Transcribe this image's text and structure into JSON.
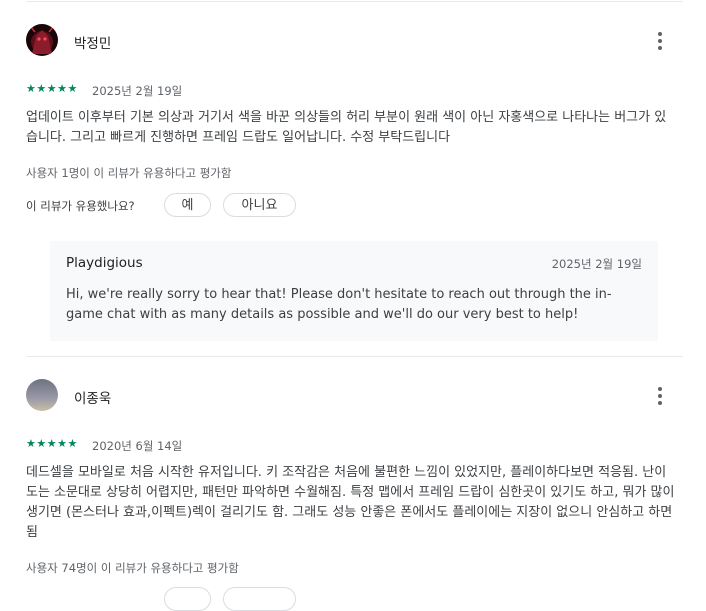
{
  "reviews": [
    {
      "author": "박정민",
      "avatar_icon": "dark-red-character-avatar",
      "stars": "★★★★★",
      "rating": 5,
      "date": "2025년 2월 19일",
      "text": "업데이트 이후부터 기본 의상과 거기서 색을 바꾼 의상들의 허리 부분이 원래 색이 아닌 자홍색으로 나타나는 버그가 있습니다. 그리고 빠르게 진행하면 프레임 드랍도 일어납니다. 수정 부탁드립니다",
      "helpful_count_text": "사용자 1명이 이 리뷰가 유용하다고 평가함",
      "helpful_question": "이 리뷰가 유용했나요?",
      "yes_label": "예",
      "no_label": "아니요",
      "reply": {
        "developer": "Playdigious",
        "date": "2025년 2월 19일",
        "text": "Hi, we're really sorry to hear that! Please don't hesitate to reach out through the in-game chat with as many details as possible and we'll do our very best to help!"
      }
    },
    {
      "author": "이종욱",
      "avatar_icon": "gradient-circle-avatar",
      "stars": "★★★★★",
      "rating": 5,
      "date": "2020년 6월 14일",
      "text": "데드셀을 모바일로 처음 시작한 유저입니다. 키 조작감은 처음에 불편한 느낌이 있었지만, 플레이하다보면 적응됨. 난이도는 소문대로 상당히 어렵지만, 패턴만 파악하면 수월해짐. 특정 맵에서 프레임 드랍이 심한곳이 있기도 하고, 뭐가 많이 생기면 (몬스터나 효과,이펙트)렉이 걸리기도 함. 그래도 성능 안좋은 폰에서도 플레이에는 지장이 없으니 안심하고 하면 됨",
      "helpful_count_text": "사용자 74명이 이 리뷰가 유용하다고 평가함"
    }
  ],
  "colors": {
    "star": "#01875f",
    "reply_bg": "#f8f9fa",
    "divider": "#e8eaed"
  },
  "icons": {
    "more": "more-vert-icon",
    "star": "star-icon"
  }
}
